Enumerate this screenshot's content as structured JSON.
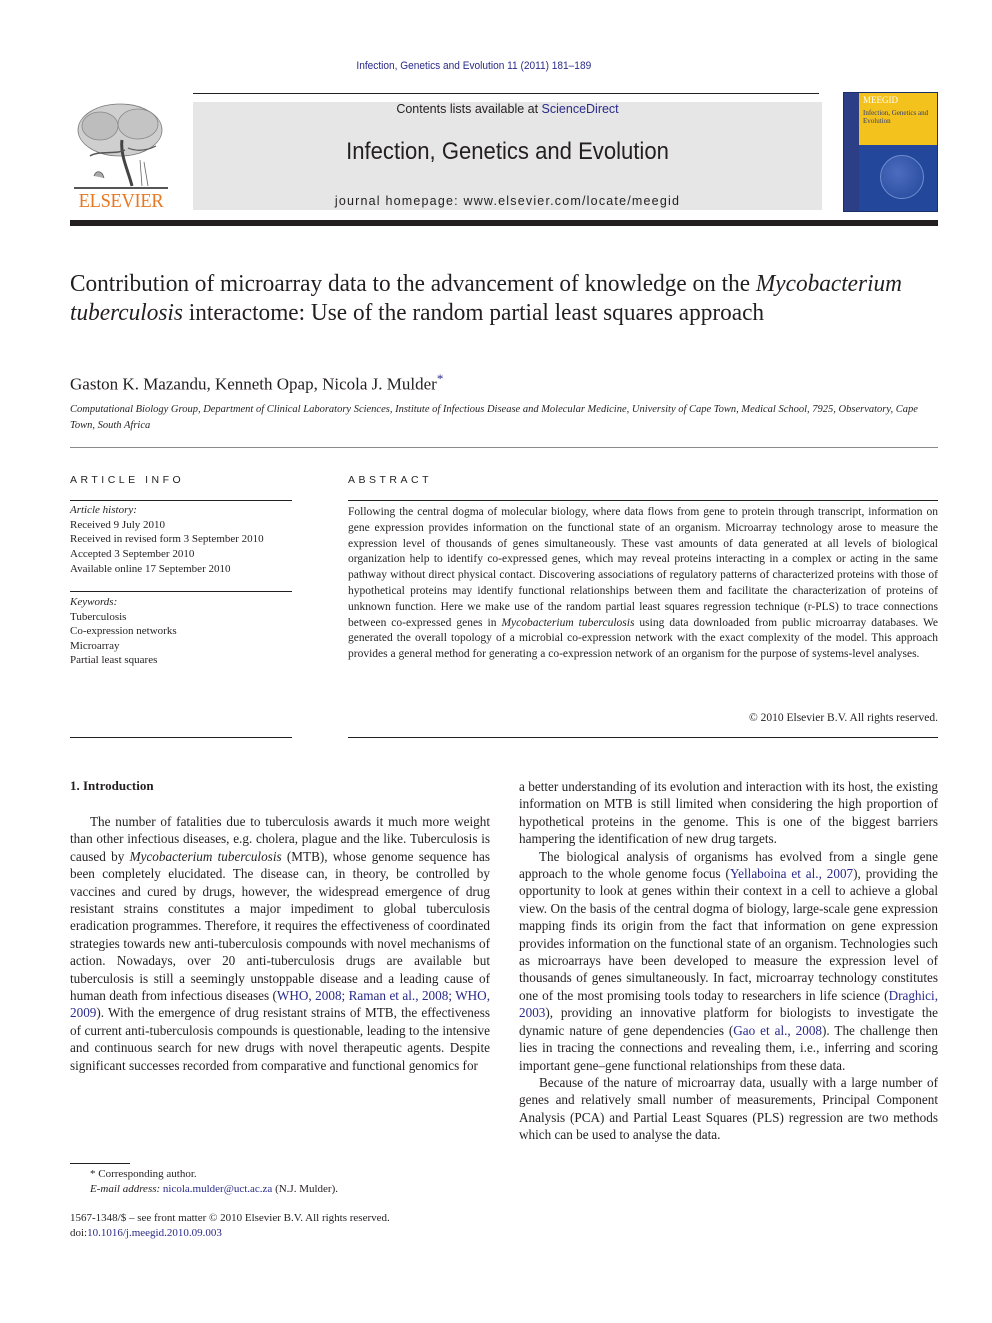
{
  "header": {
    "citation": "Infection, Genetics and Evolution 11 (2011) 181–189",
    "contents_prefix": "Contents lists available at ",
    "contents_link": "ScienceDirect",
    "journal_name": "Infection, Genetics and Evolution",
    "homepage": "journal homepage: www.elsevier.com/locate/meegid",
    "publisher_wordmark": "ELSEVIER",
    "cover": {
      "band_title": "MEEGID",
      "band_name": "Infection, Genetics and Evolution",
      "band_color": "#f4c21d",
      "cover_color": "#23479a"
    }
  },
  "article": {
    "title_part1": "Contribution of microarray data to the advancement of knowledge on the ",
    "title_italic": "Mycobacterium tuberculosis",
    "title_part2": " interactome: Use of the random partial least squares approach",
    "authors": "Gaston K. Mazandu, Kenneth Opap, Nicola J. Mulder",
    "author_mark": "*",
    "affiliation": "Computational Biology Group, Department of Clinical Laboratory Sciences, Institute of Infectious Disease and Molecular Medicine, University of Cape Town, Medical School, 7925, Observatory, Cape Town, South Africa"
  },
  "article_info": {
    "label": "ARTICLE INFO",
    "history_heading": "Article history:",
    "history": [
      "Received 9 July 2010",
      "Received in revised form 3 September 2010",
      "Accepted 3 September 2010",
      "Available online 17 September 2010"
    ],
    "keywords_heading": "Keywords:",
    "keywords": [
      "Tuberculosis",
      "Co-expression networks",
      "Microarray",
      "Partial least squares"
    ]
  },
  "abstract": {
    "label": "ABSTRACT",
    "text_part1": "Following the central dogma of molecular biology, where data flows from gene to protein through transcript, information on gene expression provides information on the functional state of an organism. Microarray technology arose to measure the expression level of thousands of genes simultaneously. These vast amounts of data generated at all levels of biological organization help to identify co-expressed genes, which may reveal proteins interacting in a complex or acting in the same pathway without direct physical contact. Discovering associations of regulatory patterns of characterized proteins with those of hypothetical proteins may identify functional relationships between them and facilitate the characterization of proteins of unknown function. Here we make use of the random partial least squares regression technique (r-PLS) to trace connections between co-expressed genes in ",
    "text_italic": "Mycobacterium tuberculosis",
    "text_part2": " using data downloaded from public microarray databases. We generated the overall topology of a microbial co-expression network with the exact complexity of the model. This approach provides a general method for generating a co-expression network of an organism for the purpose of systems-level analyses.",
    "copyright": "© 2010 Elsevier B.V. All rights reserved."
  },
  "body": {
    "intro_heading": "1.  Introduction",
    "left_p1_a": "The number of fatalities due to tuberculosis awards it much more weight than other infectious diseases, e.g. cholera, plague and the like. Tuberculosis is caused by ",
    "left_p1_italic": "Mycobacterium tuberculosis",
    "left_p1_b": " (MTB), whose genome sequence has been completely elucidated. The disease can, in theory, be controlled by vaccines and cured by drugs, however, the widespread emergence of drug resistant strains constitutes a major impediment to global tuberculosis eradication programmes. Therefore, it requires the effectiveness of coordinated strategies towards new anti-tuberculosis compounds with novel mechanisms of action. Nowadays, over 20 anti-tuberculosis drugs are available but tuberculosis is still a seemingly unstoppable disease and a leading cause of human death from infectious diseases (",
    "left_ref1": "WHO, 2008; Raman et al., 2008; WHO, 2009",
    "left_p1_c": "). With the emergence of drug resistant strains of MTB, the effectiveness of current anti-tuberculosis compounds is questionable, leading to the intensive and continuous search for new drugs with novel therapeutic agents. Despite significant successes recorded from comparative and functional genomics for",
    "right_p0": "a better understanding of its evolution and interaction with its host, the existing information on MTB is still limited when considering the high proportion of hypothetical proteins in the genome. This is one of the biggest barriers hampering the identification of new drug targets.",
    "right_p1_a": "The biological analysis of organisms has evolved from a single gene approach to the whole genome focus (",
    "right_ref1": "Yellaboina et al., 2007",
    "right_p1_b": "), providing the opportunity to look at genes within their context in a cell to achieve a global view. On the basis of the central dogma of biology, large-scale gene expression mapping finds its origin from the fact that information on gene expression provides information on the functional state of an organism. Technologies such as microarrays have been developed to measure the expression level of thousands of genes simultaneously. In fact, microarray technology constitutes one of the most promising tools today to researchers in life science (",
    "right_ref2": "Draghici, 2003",
    "right_p1_c": "), providing an innovative platform for biologists to investigate the dynamic nature of gene dependencies (",
    "right_ref3": "Gao et al., 2008",
    "right_p1_d": "). The challenge then lies in tracing the connections and revealing them, i.e., inferring and scoring important gene–gene functional relationships from these data.",
    "right_p2": "Because of the nature of microarray data, usually with a large number of genes and relatively small number of measurements, Principal Component Analysis (PCA) and Partial Least Squares (PLS) regression are two methods which can be used to analyse the data."
  },
  "footnote": {
    "mark": "*",
    "corresponding": "Corresponding author.",
    "email_label": "E-mail address:",
    "email": "nicola.mulder@uct.ac.za",
    "email_suffix": "(N.J. Mulder).",
    "front_matter": "1567-1348/$ – see front matter © 2010 Elsevier B.V. All rights reserved.",
    "doi_label": "doi:",
    "doi": "10.1016/j.meegid.2010.09.003"
  },
  "colors": {
    "link": "#2a2a8a",
    "elsevier_orange": "#e87722",
    "masthead_bg": "#e6e6e6"
  }
}
